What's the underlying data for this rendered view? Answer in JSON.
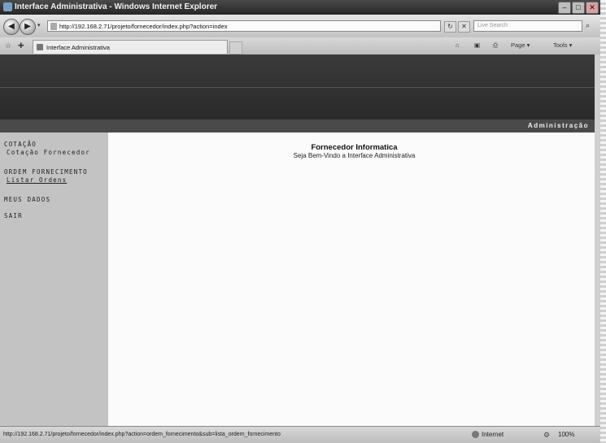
{
  "window": {
    "title": "Interface Administrativa - Windows Internet Explorer",
    "minimize": "–",
    "maximize": "□",
    "close": "✕"
  },
  "addressbar": {
    "back": "◀",
    "forward": "▶",
    "history_dropdown": "▾",
    "url": "http://192.168.2.71/projeto/fornecedor/index.php?action=index",
    "refresh": "↻",
    "stop": "✕",
    "search_placeholder": "Live Search",
    "search_button": "⌕"
  },
  "tabbar": {
    "favorites_icon": "☆",
    "add_favorite_icon": "✚",
    "tab_label": "Interface Administrativa",
    "home": "⌂",
    "feeds": "▣",
    "print": "⎙",
    "page_menu": "Page ▾",
    "tools_menu": "Tools ▾"
  },
  "header": {
    "section": "Administração"
  },
  "sidebar": {
    "items": [
      {
        "label": "COTAÇÃO",
        "sub": "Cotação Fornecedor"
      },
      {
        "label": "ORDEM FORNECIMENTO",
        "sub": "Listar Ordens"
      },
      {
        "label": "MEUS DADOS"
      },
      {
        "label": "SAIR"
      }
    ]
  },
  "main": {
    "title": "Fornecedor Informatica",
    "subtitle": "Seja Bem-Vindo a Interface Administrativa"
  },
  "statusbar": {
    "status_url": "http://192.168.2.71/projeto/fornecedor/index.php?action=ordem_fornecimento&sub=lista_ordem_fornecimento",
    "zone": "Internet",
    "zoom": "100%"
  }
}
